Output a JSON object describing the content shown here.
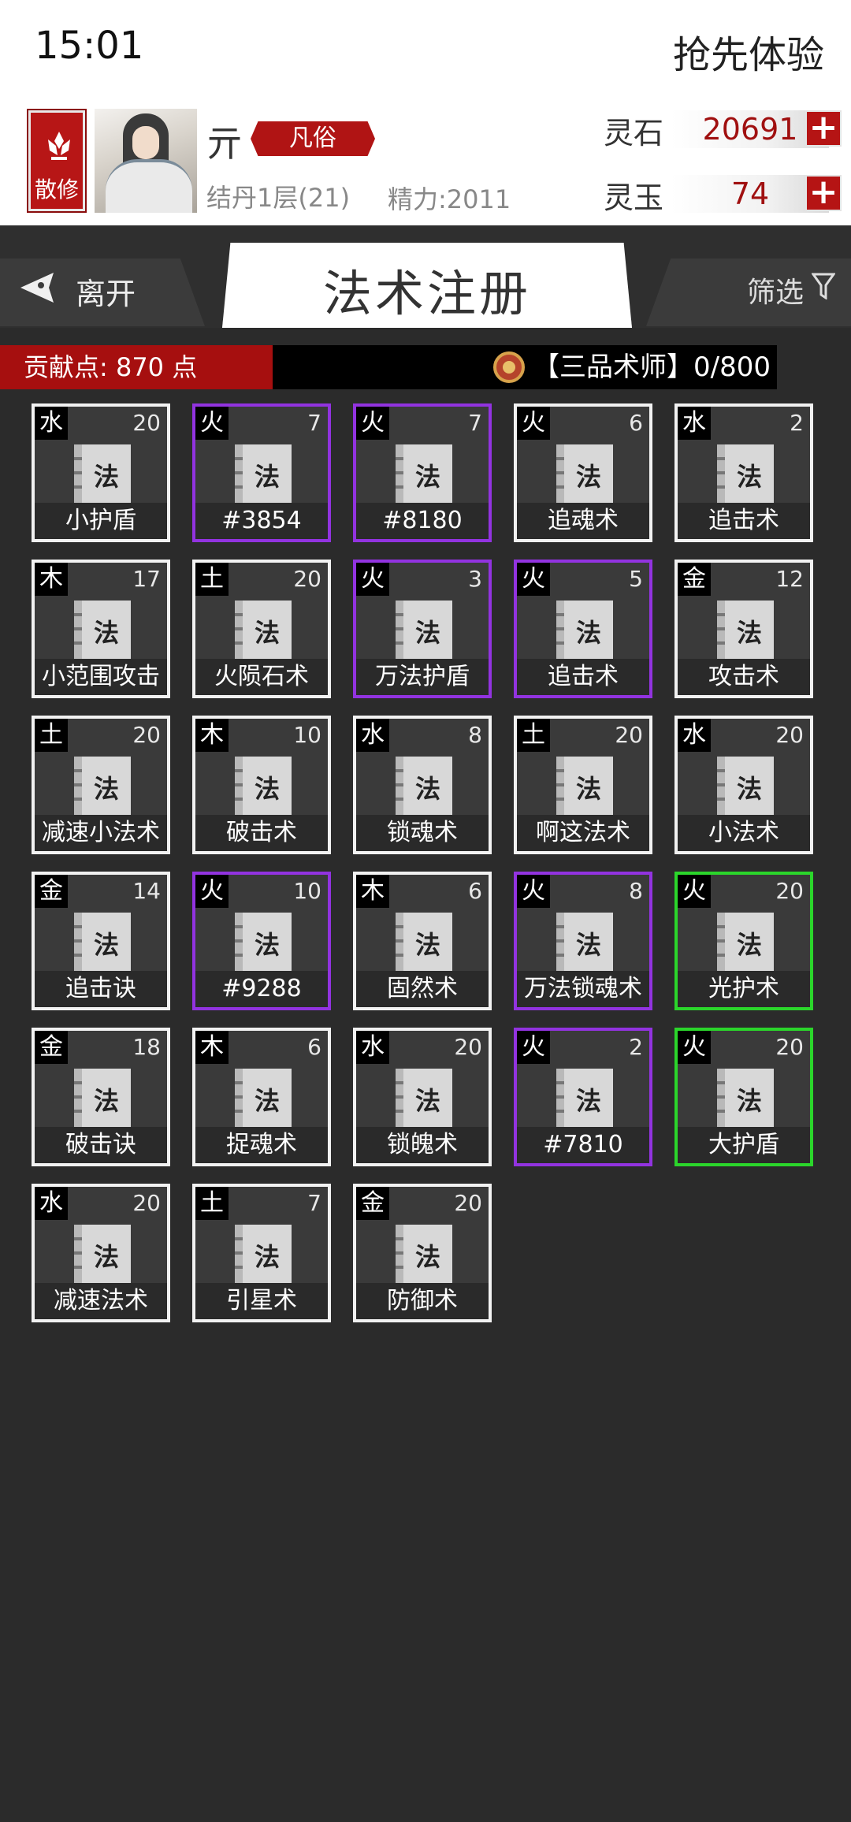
{
  "status_bar": {
    "time": "15:01",
    "early_access": "抢先体验"
  },
  "profile": {
    "sect_label": "散修",
    "name": "亓",
    "rank": "凡俗",
    "realm": "结丹1层(21)",
    "energy": "精力:2011",
    "lingshi_label": "灵石",
    "lingshi_value": "20691",
    "lingyu_label": "灵玉",
    "lingyu_value": "74",
    "plus": "+"
  },
  "nav": {
    "back_label": "离开",
    "title": "法术注册",
    "filter_label": "筛选"
  },
  "info_bar": {
    "contribution": "贡献点: 870 点",
    "rank_title": "【三品术师】0/800"
  },
  "book_glyph": "法",
  "spells": [
    {
      "element": "水",
      "level": "20",
      "name": "小护盾",
      "rarity": "white"
    },
    {
      "element": "火",
      "level": "7",
      "name": "#3854",
      "rarity": "purple"
    },
    {
      "element": "火",
      "level": "7",
      "name": "#8180",
      "rarity": "purple"
    },
    {
      "element": "火",
      "level": "6",
      "name": "追魂术",
      "rarity": "white"
    },
    {
      "element": "水",
      "level": "2",
      "name": "追击术",
      "rarity": "white"
    },
    {
      "element": "木",
      "level": "17",
      "name": "小范围攻击",
      "rarity": "white"
    },
    {
      "element": "土",
      "level": "20",
      "name": "火陨石术",
      "rarity": "white"
    },
    {
      "element": "火",
      "level": "3",
      "name": "万法护盾",
      "rarity": "purple"
    },
    {
      "element": "火",
      "level": "5",
      "name": "追击术",
      "rarity": "purple"
    },
    {
      "element": "金",
      "level": "12",
      "name": "攻击术",
      "rarity": "white"
    },
    {
      "element": "土",
      "level": "20",
      "name": "减速小法术",
      "rarity": "white"
    },
    {
      "element": "木",
      "level": "10",
      "name": "破击术",
      "rarity": "white"
    },
    {
      "element": "水",
      "level": "8",
      "name": "锁魂术",
      "rarity": "white"
    },
    {
      "element": "土",
      "level": "20",
      "name": "啊这法术",
      "rarity": "white"
    },
    {
      "element": "水",
      "level": "20",
      "name": "小法术",
      "rarity": "white"
    },
    {
      "element": "金",
      "level": "14",
      "name": "追击诀",
      "rarity": "white"
    },
    {
      "element": "火",
      "level": "10",
      "name": "#9288",
      "rarity": "purple"
    },
    {
      "element": "木",
      "level": "6",
      "name": "固然术",
      "rarity": "white"
    },
    {
      "element": "火",
      "level": "8",
      "name": "万法锁魂术",
      "rarity": "purple"
    },
    {
      "element": "火",
      "level": "20",
      "name": "光护术",
      "rarity": "green"
    },
    {
      "element": "金",
      "level": "18",
      "name": "破击诀",
      "rarity": "white"
    },
    {
      "element": "木",
      "level": "6",
      "name": "捉魂术",
      "rarity": "white"
    },
    {
      "element": "水",
      "level": "20",
      "name": "锁魄术",
      "rarity": "white"
    },
    {
      "element": "火",
      "level": "2",
      "name": "#7810",
      "rarity": "purple"
    },
    {
      "element": "火",
      "level": "20",
      "name": "大护盾",
      "rarity": "green"
    },
    {
      "element": "水",
      "level": "20",
      "name": "减速法术",
      "rarity": "white"
    },
    {
      "element": "土",
      "level": "7",
      "name": "引星术",
      "rarity": "white"
    },
    {
      "element": "金",
      "level": "20",
      "name": "防御术",
      "rarity": "white"
    }
  ]
}
